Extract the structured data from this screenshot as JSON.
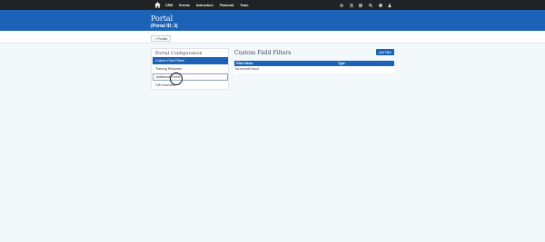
{
  "nav": {
    "items": [
      "CRM",
      "Events",
      "Instructors",
      "Financial",
      "Team"
    ],
    "icons": [
      "gear-icon",
      "list-icon",
      "grid-icon",
      "search-icon",
      "help-icon",
      "user-icon"
    ]
  },
  "header": {
    "title": "Portal",
    "subtitle": "(Portal ID: 3)"
  },
  "toolbar": {
    "back_label": "< Portals"
  },
  "sidebar": {
    "title": "Portal Configuration",
    "items": [
      {
        "label": "Custom Field Filters",
        "state": "active"
      },
      {
        "label": "Training Requests",
        "state": "normal"
      },
      {
        "label": "Additional Fields",
        "state": "focused"
      },
      {
        "label": "Gift Vouchers",
        "state": "normal"
      }
    ]
  },
  "main": {
    "title": "Custom Field Filters",
    "add_button": "Add Filter",
    "table": {
      "columns": [
        "Filter Name",
        "Type"
      ],
      "empty_message": "No records found"
    }
  },
  "colors": {
    "topbar": "#212225",
    "header": "#1c63b8",
    "accent": "#1c63b8",
    "background": "#f3f8fb"
  }
}
